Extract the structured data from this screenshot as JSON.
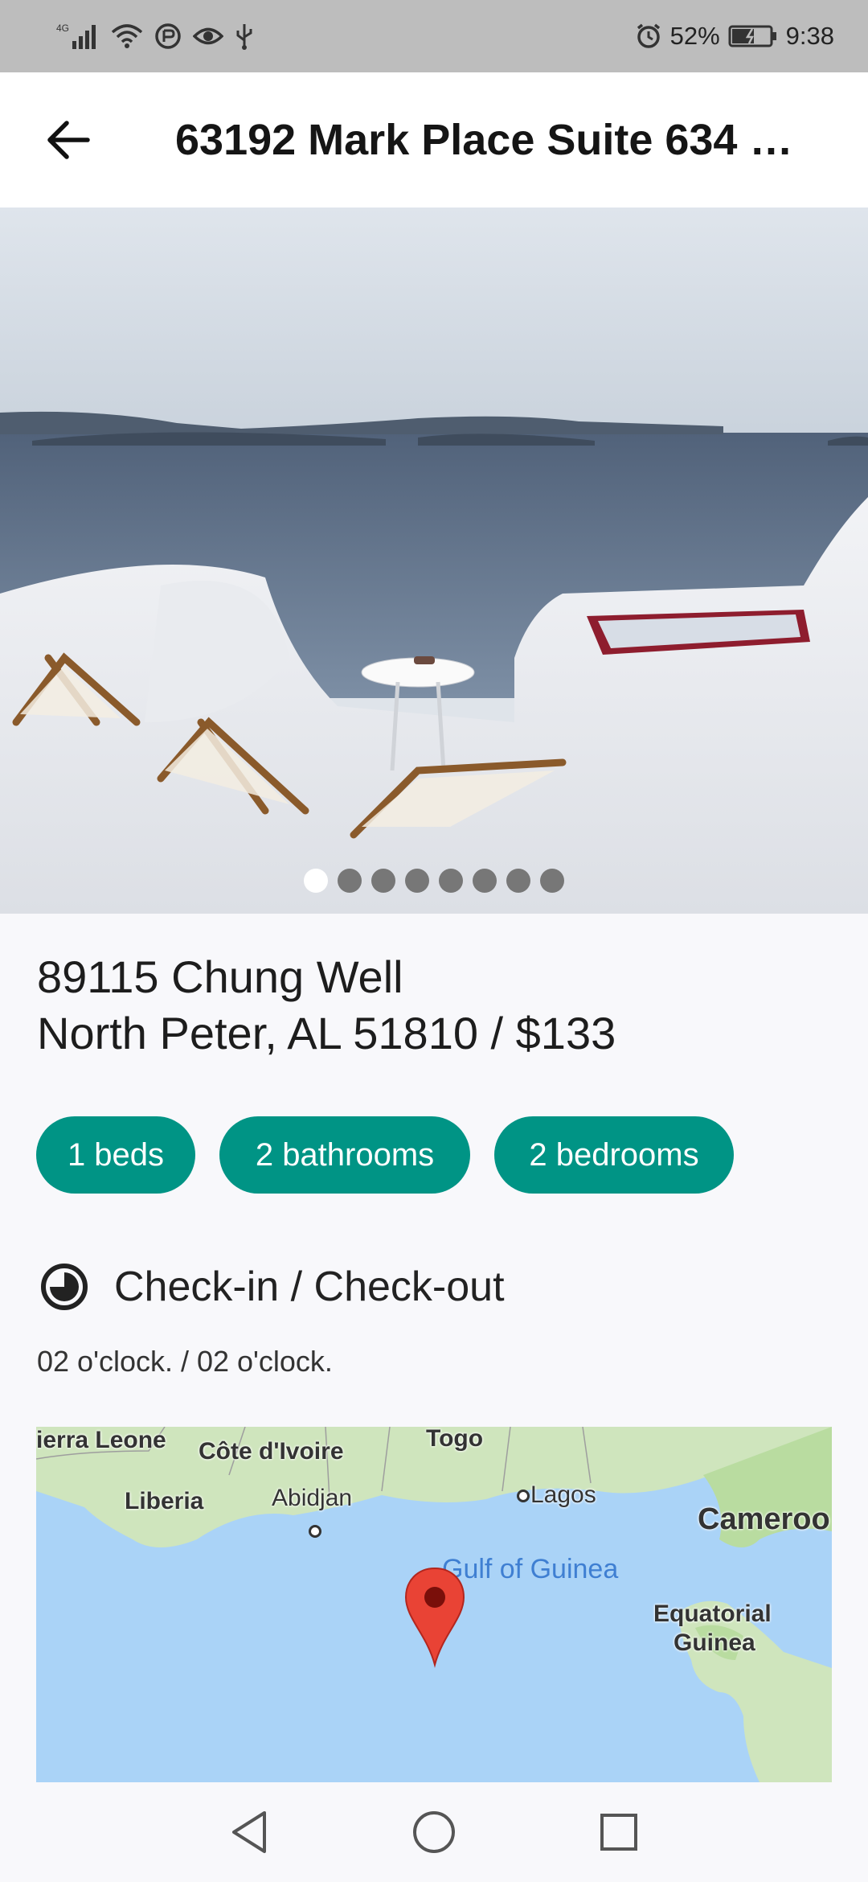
{
  "status_bar": {
    "network_label": "4G",
    "battery": "52%",
    "time": "9:38",
    "icons": [
      "signal-icon",
      "wifi-icon",
      "data-saver-icon",
      "eye-icon",
      "usb-icon",
      "alarm-icon",
      "battery-icon"
    ]
  },
  "app_bar": {
    "title": "63192 Mark Place Suite 634 …",
    "back_icon": "back-arrow-icon"
  },
  "gallery": {
    "page_count": 8,
    "active_page": 1
  },
  "listing": {
    "address_line1": "89115 Chung Well",
    "address_line2": "North Peter, AL 51810 / $133"
  },
  "chips": {
    "beds": "1 beds",
    "bathrooms": "2 bathrooms",
    "bedrooms": "2 bedrooms"
  },
  "checkin": {
    "icon": "clock-icon",
    "title": "Check-in / Check-out",
    "times": "02 o'clock. / 02 o'clock."
  },
  "map": {
    "labels": {
      "sierra_leone": "ierra Leone",
      "cote_divoire": "Côte d'Ivoire",
      "togo": "Togo",
      "liberia": "Liberia",
      "abidjan": "Abidjan",
      "lagos": "Lagos",
      "cameroon": "Cameroo",
      "gulf_of_guinea": "Gulf of Guinea",
      "equatorial_guinea_1": "Equatorial",
      "equatorial_guinea_2": "Guinea"
    },
    "marker_icon": "map-pin-icon"
  },
  "nav_bar": {
    "back": "nav-back-icon",
    "home": "nav-home-icon",
    "recents": "nav-recents-icon"
  },
  "colors": {
    "accent": "#009485",
    "status_bar": "#bdbdbd",
    "water": "#aad3f7",
    "land": "#cfe5bd",
    "marker": "#e94335"
  }
}
